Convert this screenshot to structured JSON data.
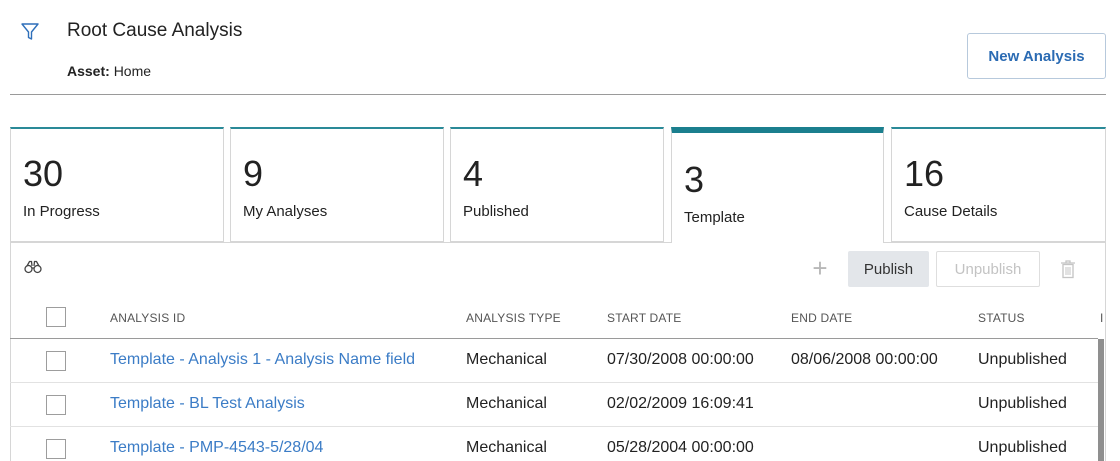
{
  "header": {
    "title": "Root Cause Analysis",
    "asset_label": "Asset:",
    "asset_value": "Home",
    "new_analysis_label": "New Analysis"
  },
  "tiles": [
    {
      "count": "30",
      "label": "In Progress"
    },
    {
      "count": "9",
      "label": "My Analyses"
    },
    {
      "count": "4",
      "label": "Published"
    },
    {
      "count": "3",
      "label": "Template",
      "active": true
    },
    {
      "count": "16",
      "label": "Cause Details"
    }
  ],
  "toolbar": {
    "publish_label": "Publish",
    "unpublish_label": "Unpublish",
    "add_icon": "plus-icon",
    "search_icon": "binoculars-icon",
    "delete_icon": "trash-icon"
  },
  "table": {
    "columns": [
      "ANALYSIS ID",
      "ANALYSIS TYPE",
      "START DATE",
      "END DATE",
      "STATUS",
      "I"
    ],
    "rows": [
      {
        "analysis_id": "Template - Analysis 1 - Analysis Name field",
        "analysis_type": "Mechanical",
        "start_date": "07/30/2008 00:00:00",
        "end_date": "08/06/2008 00:00:00",
        "status": "Unpublished"
      },
      {
        "analysis_id": "Template - BL Test Analysis",
        "analysis_type": "Mechanical",
        "start_date": "02/02/2009 16:09:41",
        "end_date": "",
        "status": "Unpublished"
      },
      {
        "analysis_id": "Template - PMP-4543-5/28/04",
        "analysis_type": "Mechanical",
        "start_date": "05/28/2004 00:00:00",
        "end_date": "",
        "status": "Unpublished"
      }
    ]
  },
  "colors": {
    "accent_teal": "#1b7f8e",
    "link_blue": "#3b7cc6",
    "button_blue": "#2b6bb3"
  }
}
